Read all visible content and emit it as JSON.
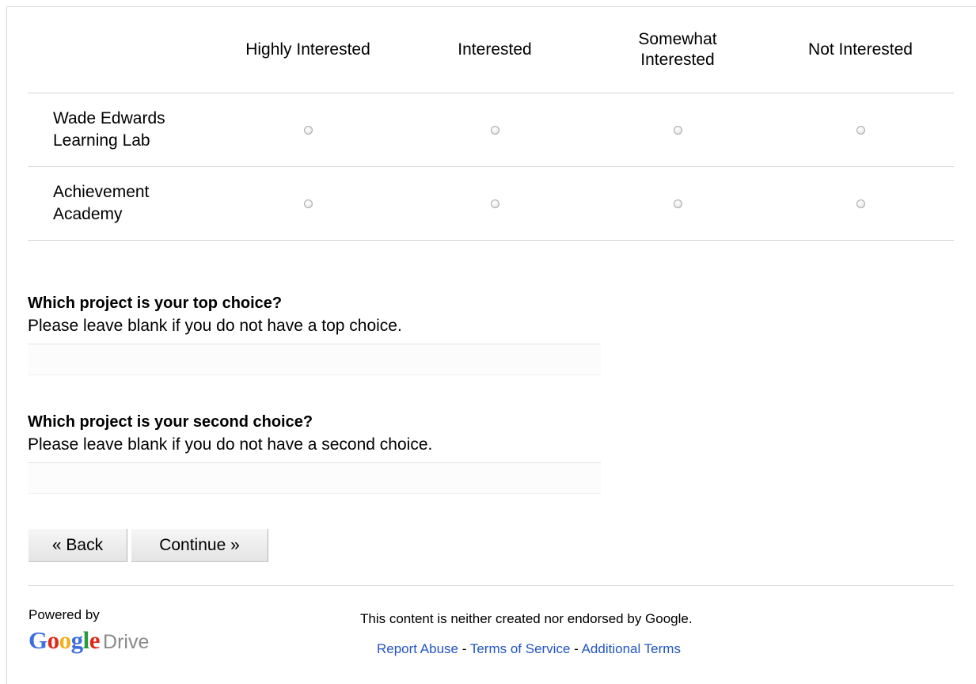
{
  "grid": {
    "columns": [
      "Highly Interested",
      "Interested",
      "Somewhat Interested",
      "Not Interested"
    ],
    "rows": [
      {
        "label": "Wade Edwards Learning Lab"
      },
      {
        "label": "Achievement Academy"
      }
    ]
  },
  "questions": [
    {
      "title": "Which project is your top choice?",
      "help": "Please leave blank if you do not have a top choice.",
      "value": ""
    },
    {
      "title": "Which project is your second choice?",
      "help": "Please leave blank if you do not have a second choice.",
      "value": ""
    }
  ],
  "buttons": {
    "back": "« Back",
    "continue": "Continue »"
  },
  "footer": {
    "powered_by": "Powered by",
    "logo_google": "Google",
    "logo_drive": "Drive",
    "disclaimer": "This content is neither created nor endorsed by Google.",
    "links": {
      "report_abuse": "Report Abuse",
      "terms": "Terms of Service",
      "additional": "Additional Terms",
      "separator": " - "
    }
  },
  "colors": {
    "link": "#2255c4",
    "google_blue": "#3d6ee0",
    "google_red": "#dd2a1b",
    "google_yellow": "#f2b01e",
    "google_green": "#2a9a3e",
    "drive_gray": "#8a8a8a"
  }
}
